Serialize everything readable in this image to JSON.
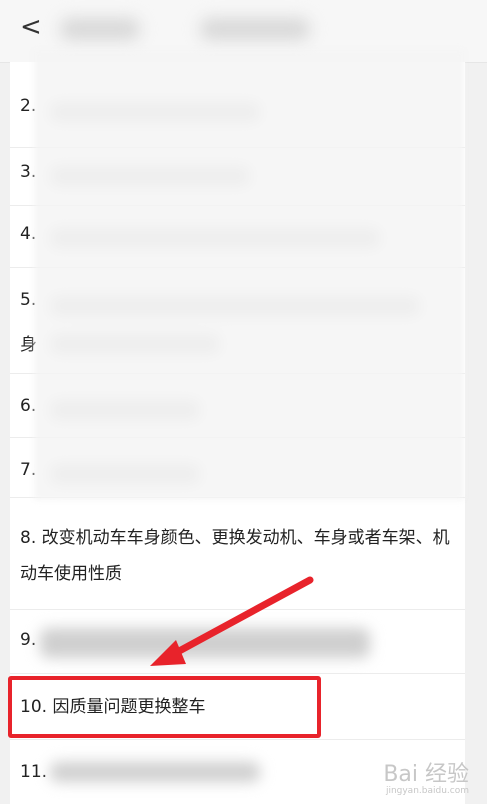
{
  "header": {
    "back_icon": "chevron-left-icon",
    "back_glyph": "<"
  },
  "items": {
    "i2": "2.",
    "i3": "3.",
    "i4": "4.",
    "i5": "5.",
    "i5b": "身",
    "i6": "6.",
    "i7": "7.",
    "i8": "8. 改变机动车车身颜色、更换发动机、车身或者车架、机动车使用性质",
    "i9": "9.",
    "i10": "10. 因质量问题更换整车",
    "i11": "11."
  },
  "annotation": {
    "highlight_color": "#e8232b",
    "arrow_color": "#e8232b"
  },
  "watermark": {
    "main": "Bai 经验",
    "sub": "jingyan.baidu.com"
  }
}
